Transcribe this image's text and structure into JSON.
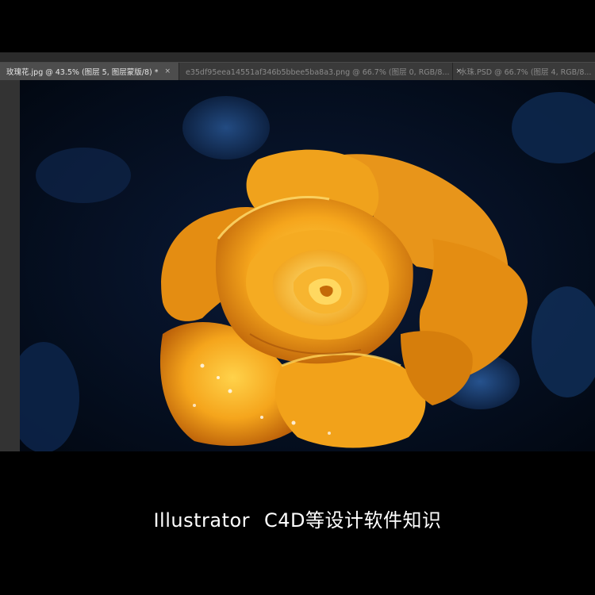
{
  "tabs": [
    {
      "title": "玫瑰花.jpg @ 43.5% (图层 5, 图层蒙版/8) *",
      "close": "×",
      "active": true
    },
    {
      "title": "e35df95eea14551af346b5bbee5ba8a3.png @ 66.7% (图层 0, RGB/8...",
      "close": "×",
      "active": false
    },
    {
      "title": "水珠.PSD @ 66.7% (图层 4, RGB/8...",
      "close": "",
      "active": false
    }
  ],
  "canvas": {
    "image": "rose-photo",
    "colors": {
      "petal": "#f2a21a",
      "highlight": "#ffd04a",
      "shadow": "#9a4a05",
      "background": "#061226",
      "leaf": "#16345e"
    }
  },
  "caption": {
    "part1": "Illustrator",
    "part2": "C4D等设计软件知识"
  }
}
